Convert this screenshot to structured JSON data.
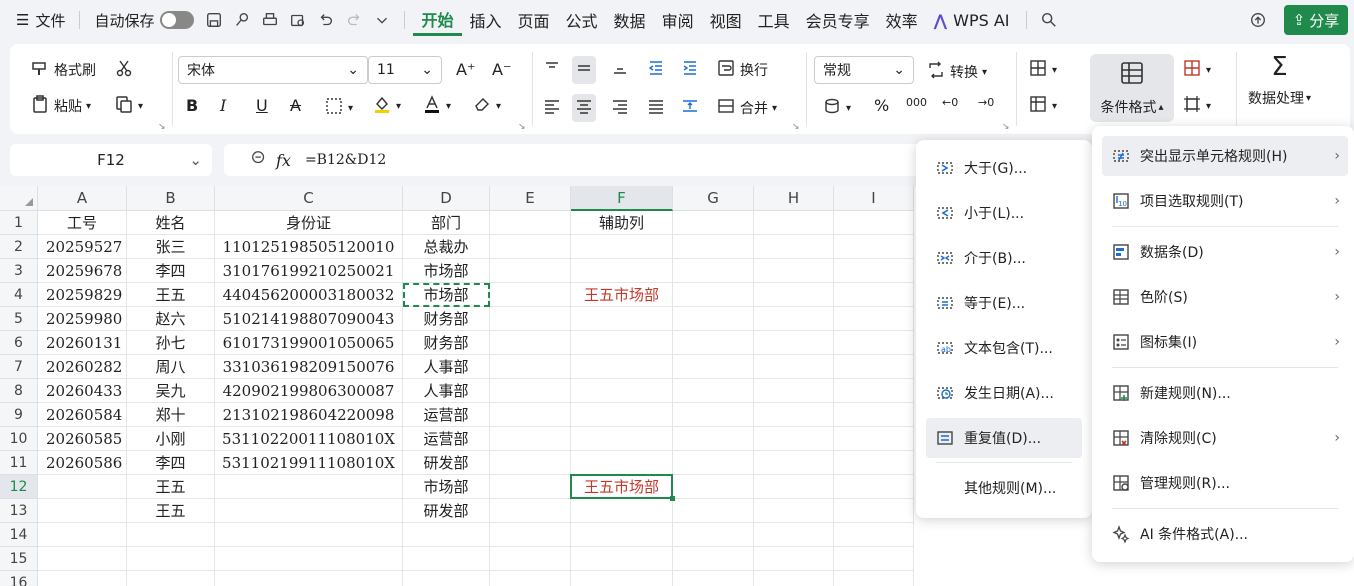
{
  "menubar": {
    "file_label": "文件",
    "autosave_label": "自动保存",
    "tabs": [
      "开始",
      "插入",
      "页面",
      "公式",
      "数据",
      "审阅",
      "视图",
      "工具",
      "会员专享",
      "效率"
    ],
    "wps_ai_label": "WPS AI",
    "share_label": "分享"
  },
  "ribbon": {
    "format_painter": "格式刷",
    "paste": "粘贴",
    "font_name": "宋体",
    "font_size": "11",
    "wrap": "换行",
    "merge": "合并",
    "number_format": "常规",
    "convert": "转换",
    "conditional_format": "条件格式",
    "data_processing": "数据处理"
  },
  "formula_bar": {
    "cell_ref": "F12",
    "fx_label": "fx",
    "formula": "=B12&D12"
  },
  "grid": {
    "columns": [
      "A",
      "B",
      "C",
      "D",
      "E",
      "F",
      "G",
      "H",
      "I"
    ],
    "selected_column": "F",
    "selected_row": "12",
    "rows": [
      {
        "n": "1",
        "cells": [
          "工号",
          "姓名",
          "身份证",
          "部门",
          "",
          "辅助列"
        ]
      },
      {
        "n": "2",
        "cells": [
          "20259527",
          "张三",
          "110125198505120010",
          "总裁办",
          "",
          ""
        ]
      },
      {
        "n": "3",
        "cells": [
          "20259678",
          "李四",
          "310176199210250021",
          "市场部",
          "",
          ""
        ]
      },
      {
        "n": "4",
        "cells": [
          "20259829",
          "王五",
          "440456200003180032",
          "市场部",
          "",
          "王五市场部"
        ]
      },
      {
        "n": "5",
        "cells": [
          "20259980",
          "赵六",
          "510214198807090043",
          "财务部",
          "",
          ""
        ]
      },
      {
        "n": "6",
        "cells": [
          "20260131",
          "孙七",
          "610173199001050065",
          "财务部",
          "",
          ""
        ]
      },
      {
        "n": "7",
        "cells": [
          "20260282",
          "周八",
          "331036198209150076",
          "人事部",
          "",
          ""
        ]
      },
      {
        "n": "8",
        "cells": [
          "20260433",
          "吴九",
          "420902199806300087",
          "人事部",
          "",
          ""
        ]
      },
      {
        "n": "9",
        "cells": [
          "20260584",
          "郑十",
          "213102198604220098",
          "运营部",
          "",
          ""
        ]
      },
      {
        "n": "10",
        "cells": [
          "20260585",
          "小刚",
          "53110220011108010X",
          "运营部",
          "",
          ""
        ]
      },
      {
        "n": "11",
        "cells": [
          "20260586",
          "李四",
          "53110219911108010X",
          "研发部",
          "",
          ""
        ]
      },
      {
        "n": "12",
        "cells": [
          "",
          "王五",
          "",
          "市场部",
          "",
          "王五市场部"
        ]
      },
      {
        "n": "13",
        "cells": [
          "",
          "王五",
          "",
          "研发部",
          "",
          ""
        ]
      },
      {
        "n": "14",
        "cells": [
          "",
          "",
          "",
          "",
          "",
          ""
        ]
      },
      {
        "n": "15",
        "cells": [
          "",
          "",
          "",
          "",
          "",
          ""
        ]
      },
      {
        "n": "16",
        "cells": [
          "",
          "",
          "",
          "",
          "",
          ""
        ]
      }
    ]
  },
  "submenu": {
    "items": [
      "大于(G)...",
      "小于(L)...",
      "介于(B)...",
      "等于(E)...",
      "文本包含(T)...",
      "发生日期(A)...",
      "重复值(D)...",
      "其他规则(M)..."
    ]
  },
  "cond_menu": {
    "items": [
      "突出显示单元格规则(H)",
      "项目选取规则(T)",
      "数据条(D)",
      "色阶(S)",
      "图标集(I)",
      "新建规则(N)...",
      "清除规则(C)",
      "管理规则(R)...",
      "AI 条件格式(A)..."
    ]
  },
  "colors": {
    "accent": "#1f8a4c",
    "highlight_text": "#c0392b"
  }
}
